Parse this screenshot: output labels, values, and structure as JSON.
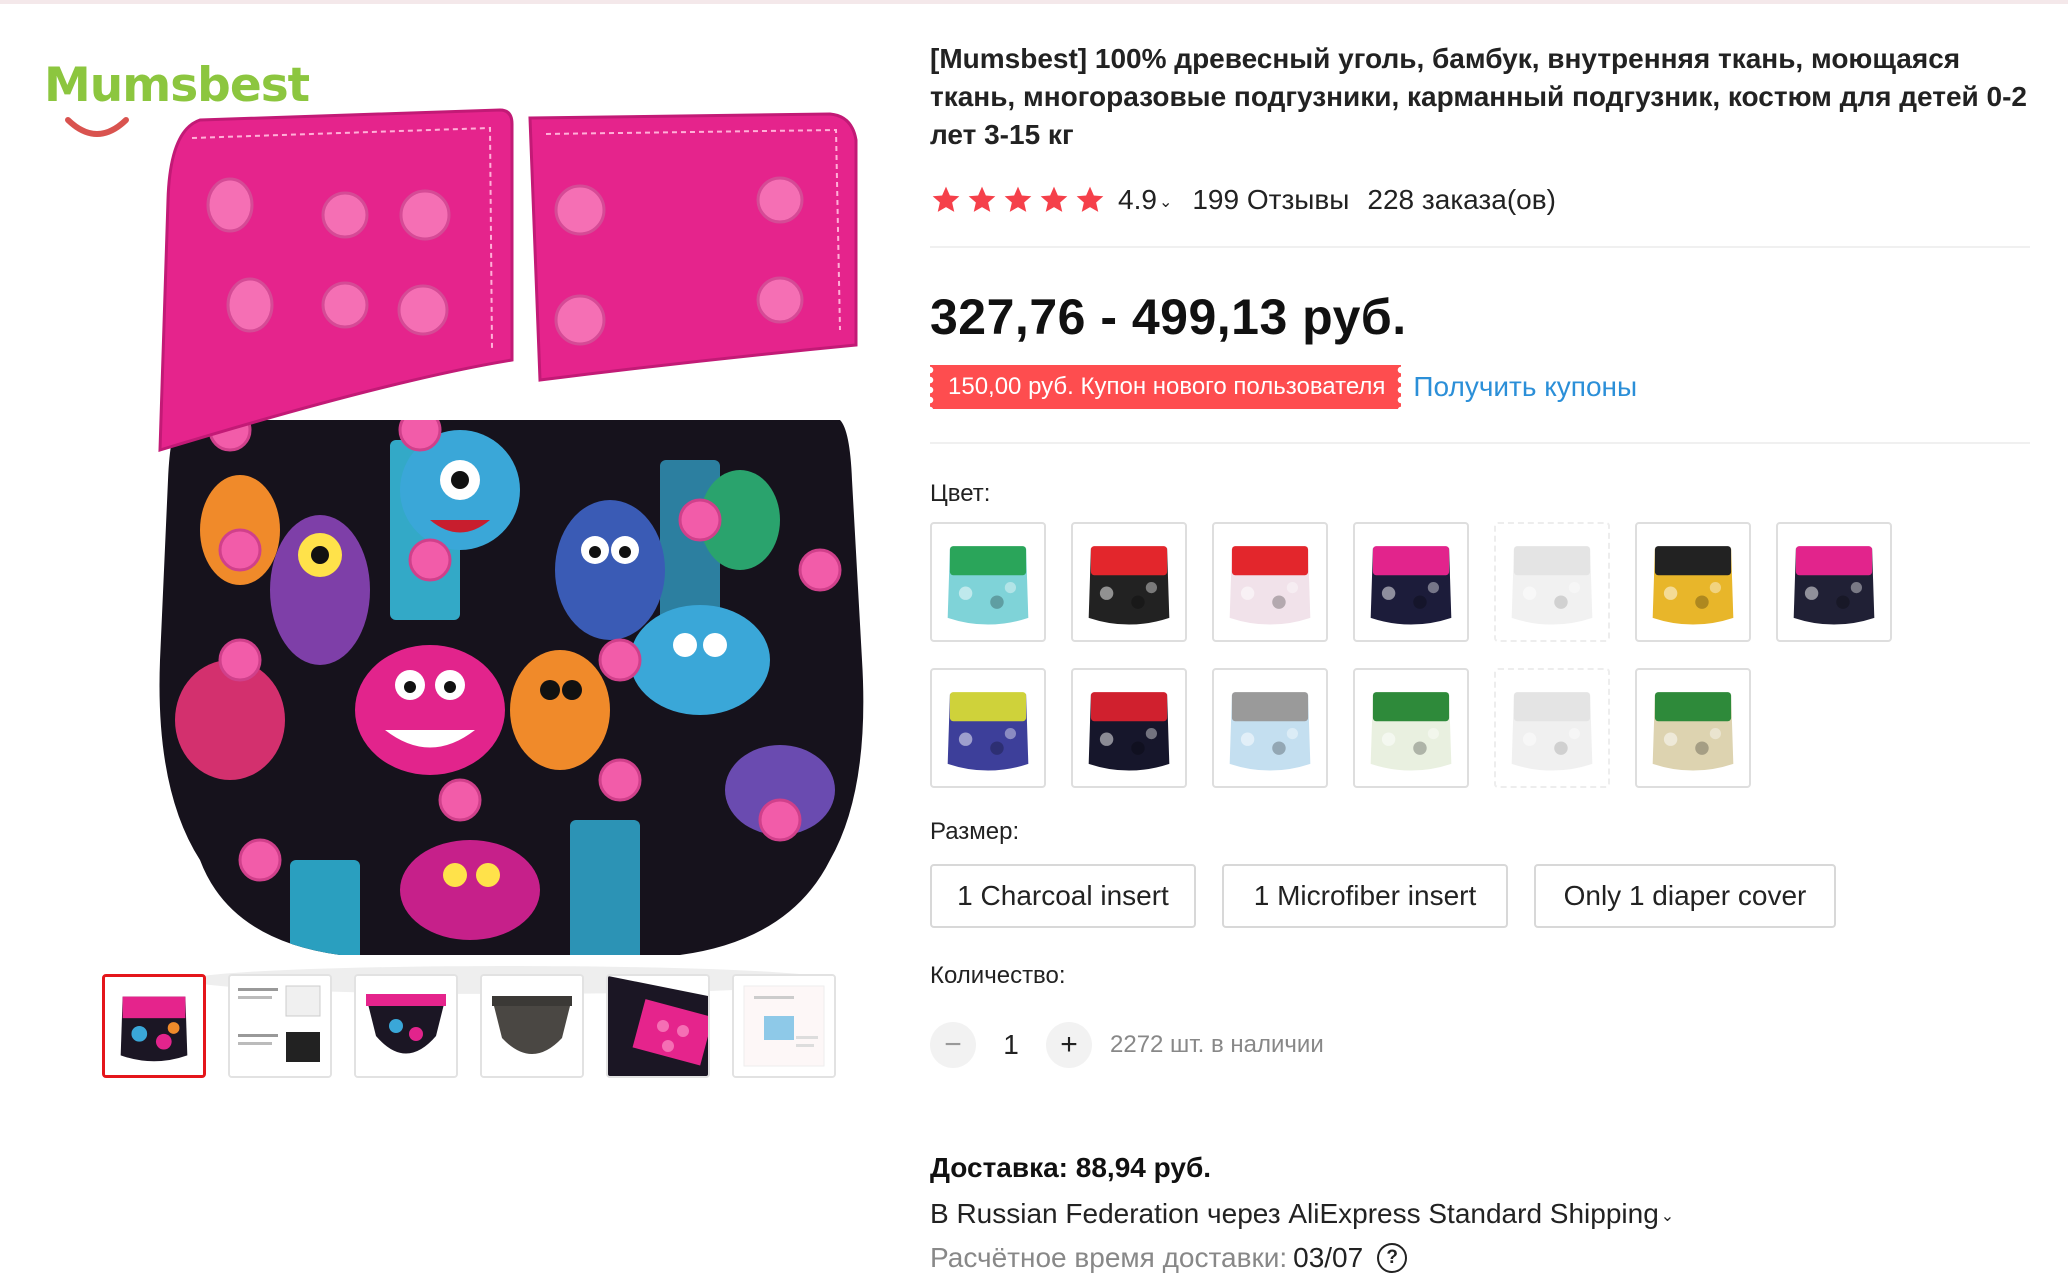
{
  "brand": {
    "logo_text": "Mumsbest"
  },
  "product": {
    "title": "[Mumsbest] 100% древесный уголь, бамбук, внутренняя ткань, моющаяся ткань, многоразовые подгузники, карманный подгузник, костюм для детей 0-2 лет 3-15 кг",
    "rating": "4.9",
    "rating_stars": 5,
    "reviews": "199 Отзывы",
    "orders": "228 заказа(ов)",
    "price": "327,76 - 499,13 руб.",
    "coupon": {
      "text": "150,00 руб. Купон нового пользователя",
      "link": "Получить купоны"
    }
  },
  "gallery": {
    "thumbnails": [
      {
        "icon": "monster-diaper-thumbnail",
        "active": true
      },
      {
        "icon": "inserts-thumbnail",
        "active": false
      },
      {
        "icon": "diaper-open-thumbnail",
        "active": false
      },
      {
        "icon": "grey-lining-thumbnail",
        "active": false
      },
      {
        "icon": "snaps-closeup-thumbnail",
        "active": false
      },
      {
        "icon": "size-chart-thumbnail",
        "active": false
      }
    ]
  },
  "color": {
    "label": "Цвет:",
    "swatches": [
      {
        "top": "#2aa55a",
        "body": "#7fd3d8",
        "available": true
      },
      {
        "top": "#e3262c",
        "body": "#222222",
        "available": true
      },
      {
        "top": "#e3262c",
        "body": "#f1e2ea",
        "available": true
      },
      {
        "top": "#e2248c",
        "body": "#1c1c3a",
        "available": true
      },
      {
        "top": "#cfcfcf",
        "body": "#e6e6e6",
        "available": false
      },
      {
        "top": "#222222",
        "body": "#e8b62a",
        "available": true
      },
      {
        "top": "#e2248c",
        "body": "#202035",
        "available": true
      },
      {
        "top": "#cfd23a",
        "body": "#3d3f9a",
        "available": true
      },
      {
        "top": "#d0202e",
        "body": "#16162b",
        "available": true
      },
      {
        "top": "#9a9a9a",
        "body": "#c4dff0",
        "available": true
      },
      {
        "top": "#2e8a3a",
        "body": "#e9f0e0",
        "available": true
      },
      {
        "top": "#cfcfcf",
        "body": "#e4e4e4",
        "available": false
      },
      {
        "top": "#2e8a3a",
        "body": "#ddd3b0",
        "available": true
      }
    ]
  },
  "size": {
    "label": "Размер:",
    "options": [
      "1 Charcoal insert",
      "1 Microfiber insert",
      "Only 1 diaper cover"
    ]
  },
  "quantity": {
    "label": "Количество:",
    "value": "1",
    "minus": "−",
    "plus": "+",
    "stock": "2272 шт. в наличии"
  },
  "shipping": {
    "cost": "Доставка: 88,94 руб.",
    "method": "В Russian Federation через AliExpress Standard Shipping",
    "time_label": "Расчётное время доставки:",
    "date": "03/07",
    "help": "?"
  },
  "colors": {
    "accent_red": "#fe4d4f",
    "link_blue": "#2b8fd8",
    "active_thumb_border": "#e4161b",
    "diaper_pink": "#e5248c",
    "star": "#f5404a"
  }
}
